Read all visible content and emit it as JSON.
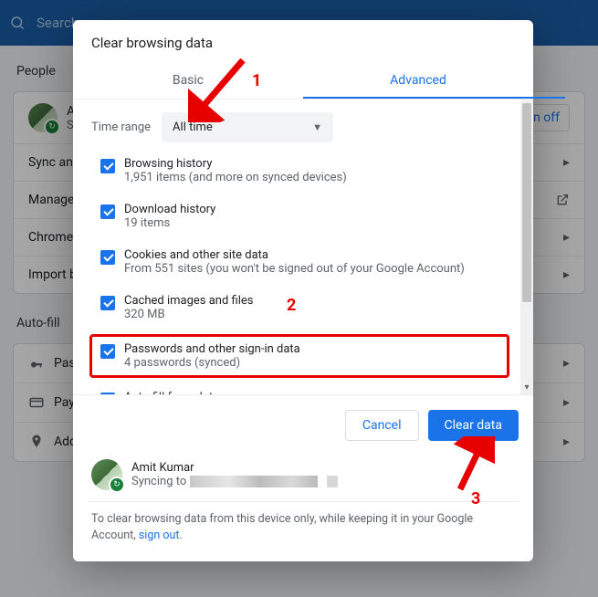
{
  "top": {
    "search": "Search"
  },
  "bg": {
    "people_title": "People",
    "profile_initial": "A",
    "profile_sync_initial": "S",
    "turn_off": "Turn off",
    "rows": {
      "sync": "Sync and G",
      "manage": "Manage yo",
      "chrome": "Chrome na",
      "import": "Import boo"
    },
    "autofill_title": "Auto-fill",
    "autofill": {
      "pass": "Pass",
      "pay": "Payr",
      "add": "Add"
    }
  },
  "dialog": {
    "title": "Clear browsing data",
    "tabs": {
      "basic": "Basic",
      "advanced": "Advanced"
    },
    "time_label": "Time range",
    "time_value": "All time",
    "opts": [
      {
        "title": "Browsing history",
        "sub": "1,951 items (and more on synced devices)"
      },
      {
        "title": "Download history",
        "sub": "19 items"
      },
      {
        "title": "Cookies and other site data",
        "sub": "From 551 sites (you won't be signed out of your Google Account)"
      },
      {
        "title": "Cached images and files",
        "sub": "320 MB"
      },
      {
        "title": "Passwords and other sign-in data",
        "sub": "4 passwords (synced)"
      },
      {
        "title": "Auto-fill form data",
        "sub": ""
      }
    ],
    "cancel": "Cancel",
    "clear": "Clear data",
    "acct_name": "Amit Kumar",
    "acct_sync": "Syncing to",
    "note_a": "To clear browsing data from this device only, while keeping it in your Google Account, ",
    "note_link": "sign out",
    "note_b": "."
  },
  "annotations": {
    "n1": "1",
    "n2": "2",
    "n3": "3"
  }
}
